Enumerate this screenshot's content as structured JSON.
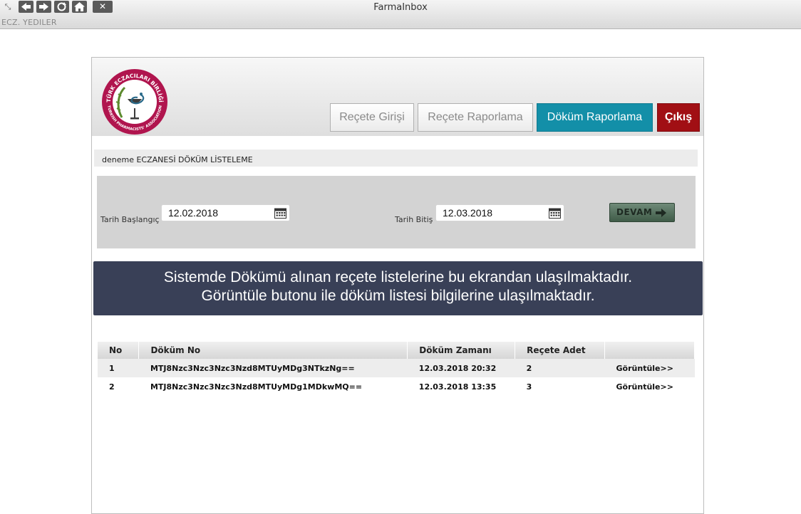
{
  "window": {
    "title": "FarmaInbox",
    "user": "ECZ. YEDILER",
    "toolbar_icons": [
      "resize-icon",
      "back-icon",
      "forward-icon",
      "refresh-icon",
      "home-icon",
      "close-icon"
    ],
    "close_glyph": "✕"
  },
  "logo": {
    "top_text": "TÜRK ECZACILARI BİRLİĞİ",
    "bottom_text": "TURKISH PHARMACISTS' ASSOCIATION",
    "ring_color": "#b0154e"
  },
  "nav": {
    "recete_girisi": "Reçete Girişi",
    "recete_raporlama": "Reçete Raporlama",
    "dokum_raporlama": "Döküm Raporlama",
    "cikis": "Çıkış"
  },
  "section_title": "deneme ECZANESİ DÖKÜM LİSTELEME",
  "filter": {
    "start_label": "Tarih Başlangıç",
    "start_value": "12.02.2018",
    "end_label": "Tarih Bitiş",
    "end_value": "12.03.2018",
    "submit_label": "DEVAM"
  },
  "info": {
    "line1": "Sistemde Dökümü alınan reçete listelerine bu ekrandan ulaşılmaktadır.",
    "line2": "Görüntüle butonu ile döküm listesi bilgilerine ulaşılmaktadır."
  },
  "table": {
    "headers": [
      "No",
      "Döküm No",
      "Döküm Zamanı",
      "Reçete Adet",
      ""
    ],
    "rows": [
      {
        "no": "1",
        "dokum_no": "MTJ8Nzc3Nzc3Nzc3Nzd8MTUyMDg3NTkzNg==",
        "zaman": "12.03.2018 20:32",
        "adet": "2",
        "action": "Görüntüle>>"
      },
      {
        "no": "2",
        "dokum_no": "MTJ8Nzc3Nzc3Nzc3Nzd8MTUyMDg1MDkwMQ==",
        "zaman": "12.03.2018 13:35",
        "adet": "3",
        "action": "Görüntüle>>"
      }
    ]
  },
  "colors": {
    "nav_active": "#138fa8",
    "nav_exit": "#a10f14",
    "info_bg": "#394057",
    "devam_bg": "#4f6b58"
  }
}
